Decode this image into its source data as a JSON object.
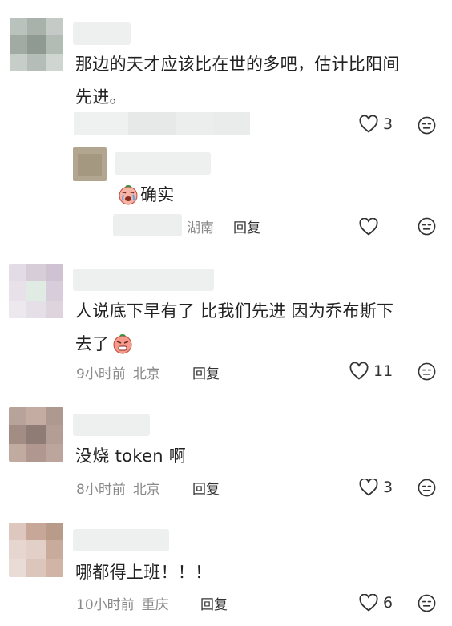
{
  "comments": [
    {
      "text_line1": "那边的天才应该比在世的多吧，估计比阳间",
      "text_line2": "先进。",
      "likes": "3",
      "replies": [
        {
          "text": "确实",
          "location": "湖南",
          "reply_label": "回复"
        }
      ]
    },
    {
      "text_line1": "人说底下早有了 比我们先进  因为乔布斯下",
      "text_line2": "去了",
      "time": "9小时前",
      "location": "北京",
      "reply_label": "回复",
      "likes": "11"
    },
    {
      "text": "没烧 token 啊",
      "time": "8小时前",
      "location": "北京",
      "reply_label": "回复",
      "likes": "3"
    },
    {
      "text": "哪都得上班！！！",
      "time": "10小时前",
      "location": "重庆",
      "reply_label": "回复",
      "likes": "6"
    }
  ],
  "icons": {
    "like": "heart-outline-icon",
    "dislike": "meh-face-icon",
    "emoji_crying": "crying-face-emoji",
    "emoji_angry": "pouting-face-emoji"
  }
}
